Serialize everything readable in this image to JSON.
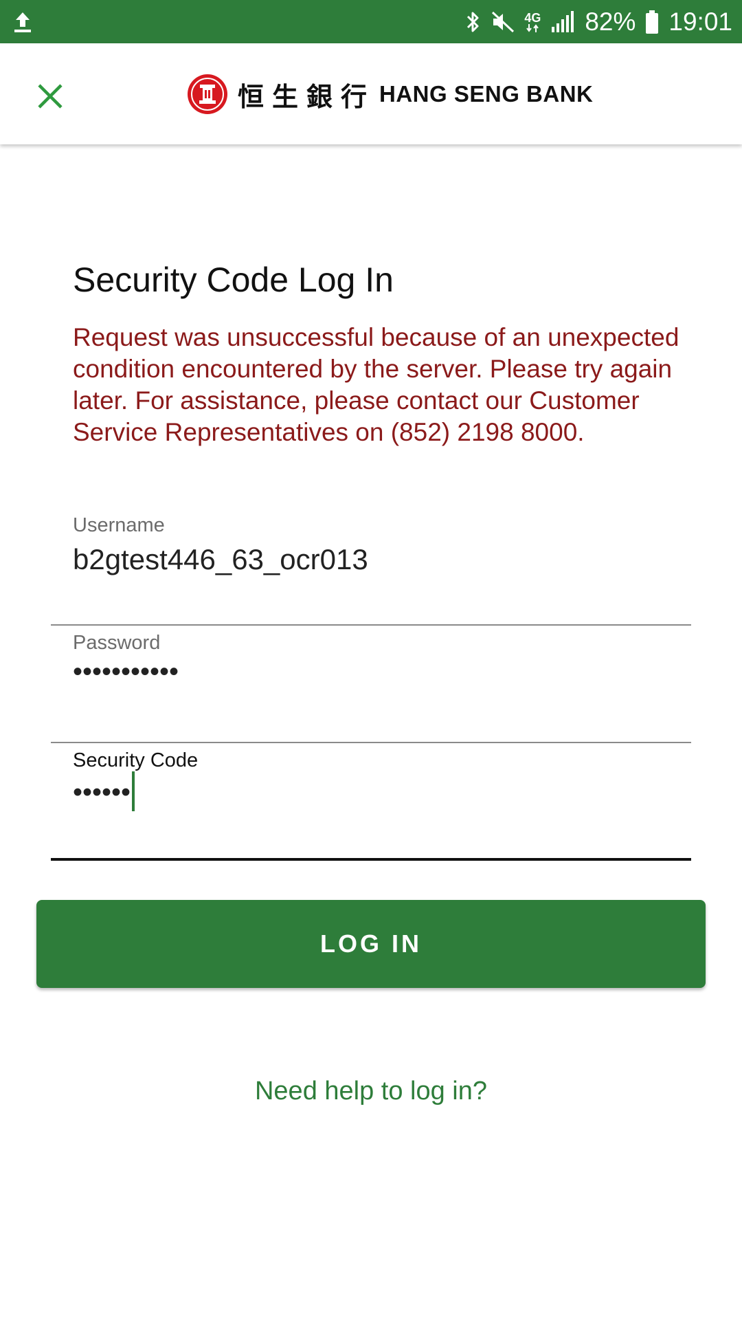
{
  "status_bar": {
    "battery_percent": "82%",
    "time": "19:01",
    "network": "4G",
    "colors": {
      "background": "#2e7d3a"
    },
    "icons": [
      "upload-icon",
      "bluetooth-icon",
      "mute-icon",
      "network-4g-icon",
      "signal-icon",
      "battery-icon"
    ]
  },
  "header": {
    "logo_chinese": "恒生銀行",
    "logo_english": "HANG SENG BANK",
    "close_icon": "close-icon"
  },
  "form": {
    "title": "Security Code Log In",
    "error_message": "Request was unsuccessful because of an unexpected condition encountered by the server. Please try again later. For assistance, please contact our Customer Service Representatives on (852) 2198 8000.",
    "username_label": "Username",
    "username_value": "b2gtest446_63_ocr013",
    "password_label": "Password",
    "password_value": "•••••••••••",
    "security_code_label": "Security Code",
    "security_code_value": "••••••",
    "login_button": "LOG IN",
    "help_link": "Need help to log in?"
  },
  "colors": {
    "brand_green": "#2e7d3a",
    "error_red": "#8b1a1a",
    "logo_red": "#d71920"
  }
}
